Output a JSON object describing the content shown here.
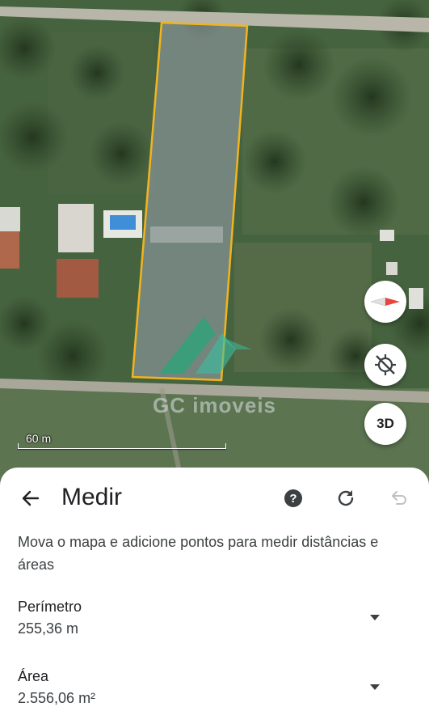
{
  "map": {
    "watermark": "GC imoveis",
    "scale_label": "60 m",
    "three_d_label": "3D",
    "icons": {
      "compass": "compass-icon",
      "location": "location-disabled-icon"
    },
    "colors": {
      "boundary": "#f2b41e",
      "fill": "#9aa3b0"
    }
  },
  "sheet": {
    "title": "Medir",
    "help_label": "?",
    "instructions": "Mova o mapa e adicione pontos para medir distâncias e áreas",
    "metrics": [
      {
        "label": "Perímetro",
        "value": "255,36 m"
      },
      {
        "label": "Área",
        "value": "2.556,06 m²"
      }
    ],
    "icons": {
      "back": "back-arrow-icon",
      "help": "help-icon",
      "refresh": "refresh-icon",
      "undo": "undo-icon",
      "expand": "chevron-down-icon"
    }
  }
}
